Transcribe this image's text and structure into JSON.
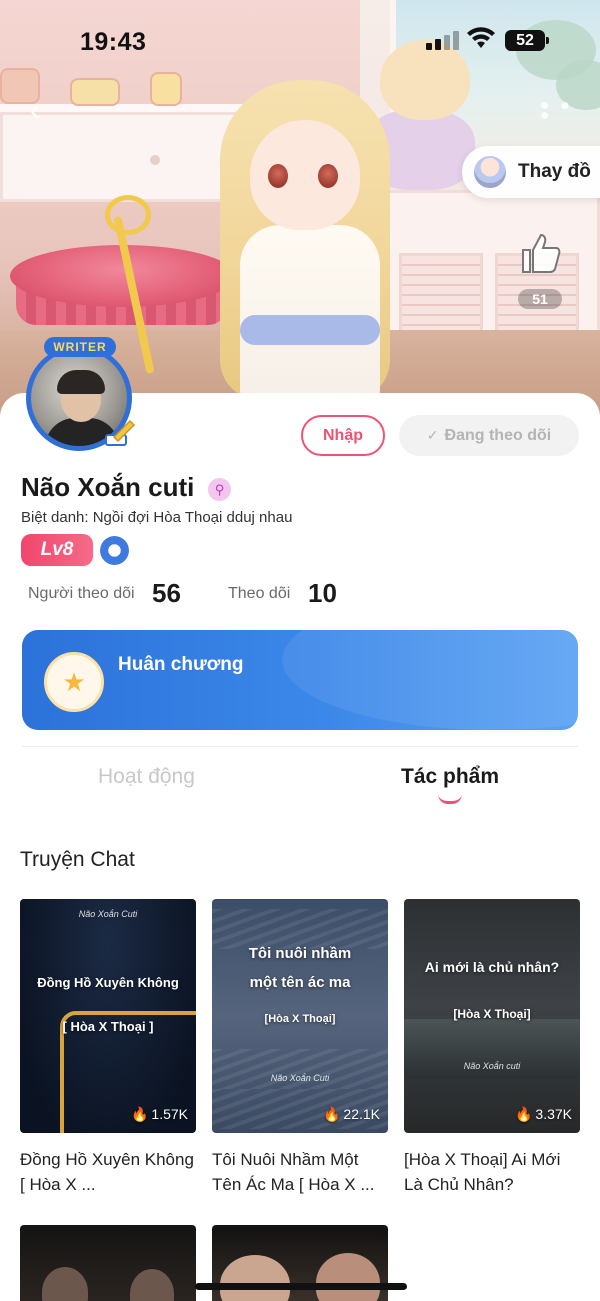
{
  "status_bar": {
    "time": "19:43",
    "battery": "52"
  },
  "hero": {
    "dress_button_label": "Thay đồ",
    "like_count": "51",
    "writer_badge": "WRITER"
  },
  "profile": {
    "name": "Não Xoắn cuti",
    "nickname": "Biệt danh: Ngồi đợi Hòa Thoại dduj nhau",
    "level": "Lv8",
    "followers_label": "Người theo dõi",
    "followers_value": "56",
    "following_label": "Theo dõi",
    "following_value": "10",
    "import_button": "Nhập",
    "following_button": "Đang theo dõi"
  },
  "medal": {
    "title": "Huân chương"
  },
  "tabs": [
    {
      "label": "Hoạt động",
      "active": false
    },
    {
      "label": "Tác phẩm",
      "active": true
    }
  ],
  "section": {
    "title": "Truyện Chat"
  },
  "stories": [
    {
      "cover_signature": "Não Xoắn Cuti",
      "cover_title": "Đồng Hồ Xuyên Không",
      "cover_subtitle": "[ Hòa X Thoại ]",
      "views": "1.57K",
      "title": "Đồng Hồ Xuyên Không [ Hòa X ..."
    },
    {
      "cover_title_line1": "Tôi nuôi nhầm",
      "cover_title_line2": "một tên ác ma",
      "cover_subtitle": "[Hòa X Thoại]",
      "cover_signature": "Não Xoắn Cuti",
      "views": "22.1K",
      "title": "Tôi Nuôi Nhầm Một Tên Ác Ma [ Hòa X ..."
    },
    {
      "cover_title": "Ai mới là chủ nhân?",
      "cover_subtitle": "[Hòa X Thoại]",
      "cover_signature": "Não Xoắn cuti",
      "views": "3.37K",
      "title": "[Hòa X Thoại] Ai Mới Là Chủ Nhân?"
    }
  ],
  "colors": {
    "accent_pink": "#f05274",
    "medal_blue": "#2b72d9",
    "level_pink": "#f2456d"
  },
  "icons": [
    "back-arrow-icon",
    "more-dots-icon",
    "thumbs-up-icon",
    "check-icon",
    "fire-icon",
    "writer-pen-icon",
    "verified-badge-icon",
    "medal-icon"
  ]
}
